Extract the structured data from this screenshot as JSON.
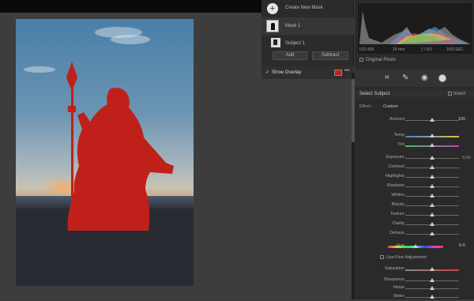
{
  "masks": {
    "create_label": "Create New Mask",
    "mask1_label": "Mask 1",
    "subject_label": "Subject 1",
    "add_label": "Add",
    "subtract_label": "Subtract",
    "show_overlay_label": "Show Overlay",
    "overlay_color": "#c0201a"
  },
  "histogram": {
    "iso": "ISO 400",
    "focal": "24 mm",
    "aperture": "ƒ / 8.0",
    "shutter": "1/60 SEC",
    "original_photo_label": "Original Photo"
  },
  "panel": {
    "select_subject": "Select Subject",
    "invert_label": "Invert",
    "effect_label": "Effect :",
    "effect_value": "Custom",
    "amount_label": "Amount",
    "amount_value": "100",
    "exposure_value": "0.00",
    "hue_label": "Hue",
    "hue_value": "0.0",
    "fine_adjust_label": "Use Fine Adjustment"
  },
  "sliders": [
    {
      "label": "Temp"
    },
    {
      "label": "Tint"
    },
    {
      "label": "Exposure"
    },
    {
      "label": "Contrast"
    },
    {
      "label": "Highlights"
    },
    {
      "label": "Shadows"
    },
    {
      "label": "Whites"
    },
    {
      "label": "Blacks"
    },
    {
      "label": "Texture"
    },
    {
      "label": "Clarity"
    },
    {
      "label": "Dehaze"
    },
    {
      "label": "Saturation"
    },
    {
      "label": "Sharpness"
    },
    {
      "label": "Noise"
    },
    {
      "label": "Moire"
    }
  ],
  "tools": [
    "crop-icon",
    "healing-icon",
    "red-eye-icon",
    "masking-icon"
  ]
}
